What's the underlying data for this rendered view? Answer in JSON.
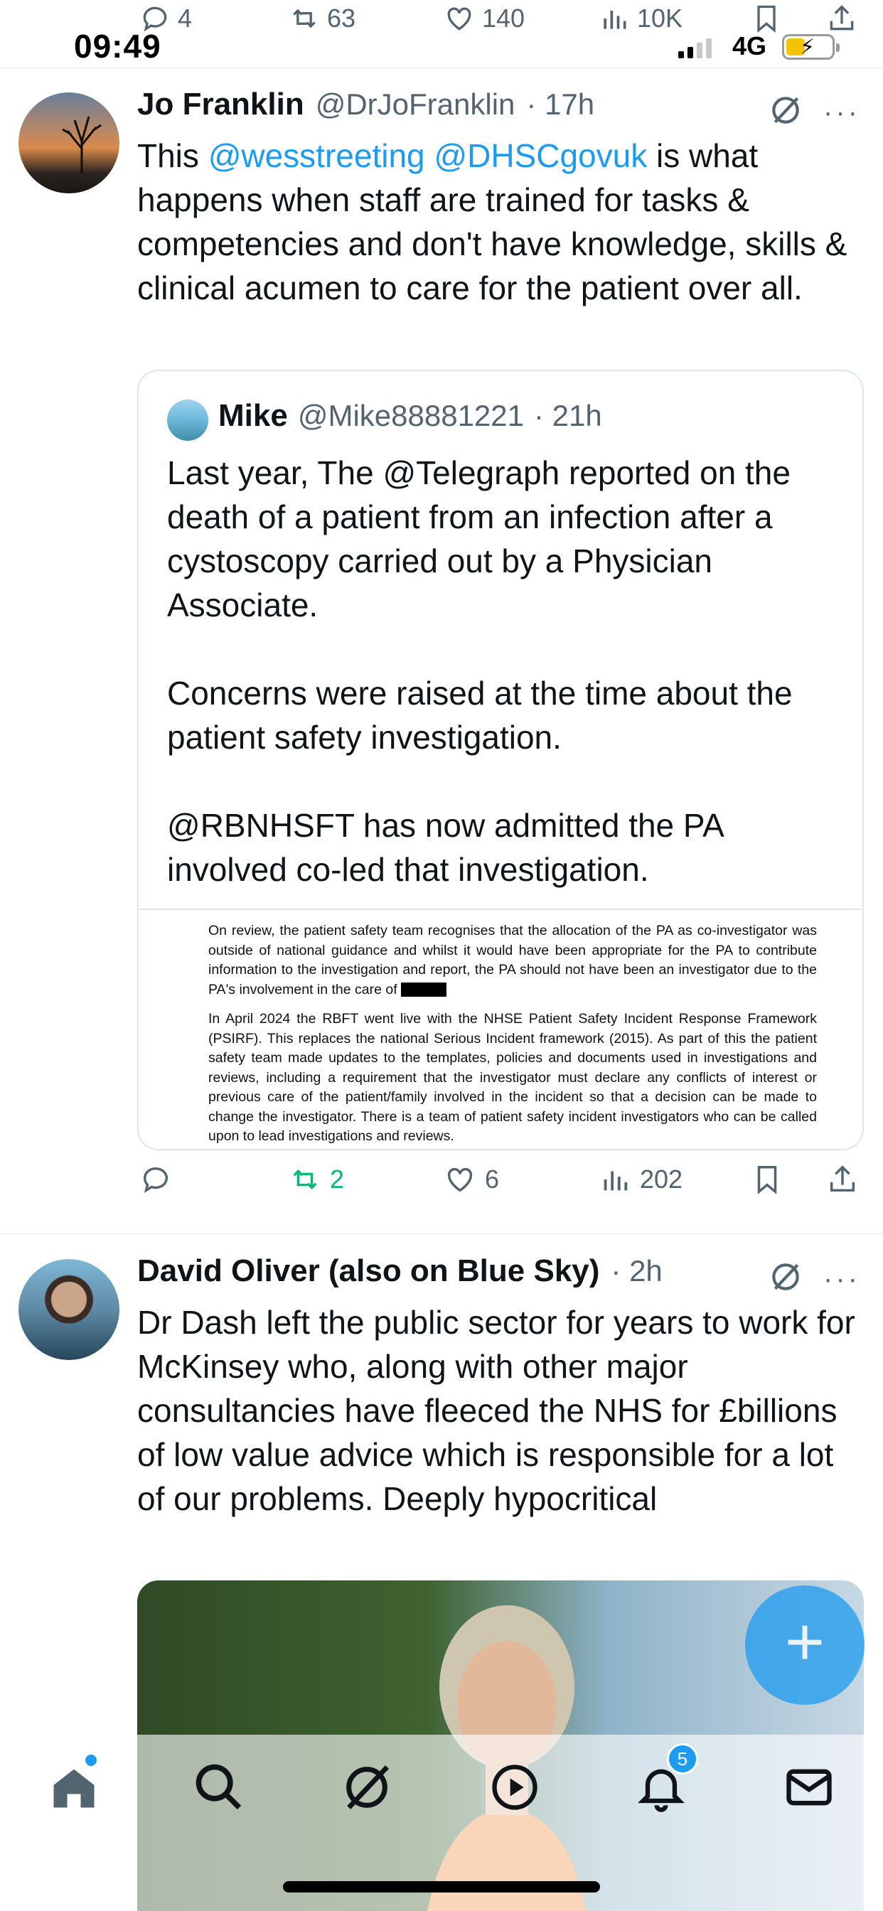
{
  "status_bar": {
    "time": "09:49",
    "network": "4G"
  },
  "previous_tweet_actions": {
    "replies": "4",
    "reposts": "63",
    "likes": "140",
    "views": "10K"
  },
  "tweets": [
    {
      "name": "Jo Franklin",
      "handle": "@DrJoFranklin",
      "time": "· 17h",
      "more": "···",
      "text_parts": {
        "before": "This ",
        "mention1": "@wesstreeting",
        "space": " ",
        "mention2": "@DHSCgovuk",
        "after": " is what happens when staff are trained for tasks & competencies and don't have knowledge, skills & clinical acumen to care for the patient over all."
      },
      "quote": {
        "name": "Mike",
        "handle": "@Mike88881221",
        "time": "· 21h",
        "text": "Last year, The @Telegraph reported on the death of a patient from an infection after a cystoscopy carried out by a Physician Associate.\n\nConcerns were raised at the time about the patient safety investigation.\n\n@RBNHSFT has now admitted the PA involved co-led that investigation.",
        "document": {
          "para1": "On review, the patient safety team recognises that the allocation of the PA as co-investigator was outside of national guidance and whilst it would have been appropriate for the PA to contribute information to the investigation and report, the PA should not have been an investigator due to the PA's involvement in the care of",
          "para2": "In April 2024 the RBFT went live with the NHSE Patient Safety Incident Response Framework (PSIRF). This replaces the national Serious Incident framework (2015). As part of this the patient safety team made updates to the templates, policies and documents used in investigations and reviews, including a requirement that the investigator must declare any conflicts of interest or previous care of the patient/family involved in the incident so that a decision can be made to change the investigator. There is a team of patient safety incident investigators who can be called upon to lead investigations and reviews."
        }
      },
      "actions": {
        "replies": "",
        "reposts": "2",
        "likes": "6",
        "views": "202"
      }
    },
    {
      "name": "David Oliver (also on Blue Sky)",
      "handle": "",
      "time": "· 2h",
      "more": "···",
      "text": "Dr Dash left the public sector for years to work for McKinsey who, along with other major consultancies have fleeced the NHS for £billions of low value advice which is responsible for a lot of our problems. Deeply hypocritical"
    }
  ],
  "fab": {
    "label": "+"
  },
  "bottom_nav": {
    "notifications_badge": "5",
    "items": [
      "home-icon",
      "search-icon",
      "grok-icon",
      "video-icon",
      "bell-icon",
      "mail-icon"
    ]
  },
  "colors": {
    "accent": "#1d9bf0",
    "repost": "#00ba7c",
    "secondary_text": "#536471"
  }
}
